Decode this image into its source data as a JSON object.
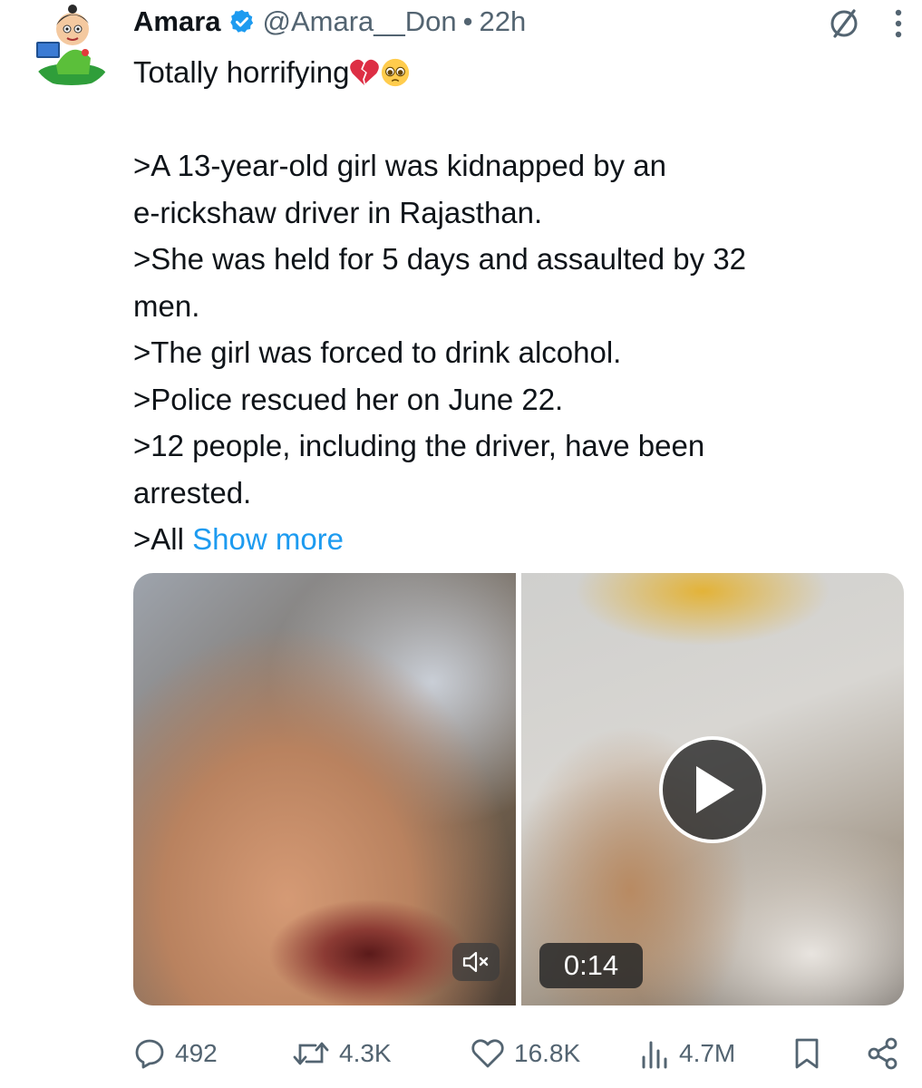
{
  "author": {
    "name": "Amara",
    "handle": "@Amara__Don",
    "separator": "•",
    "time": "22h",
    "verified_color": "#1d9bf0"
  },
  "header_icons": [
    "grok-icon",
    "more-vertical-icon"
  ],
  "tweet": {
    "first_line": "Totally horrifying",
    "first_line_emojis": [
      "broken-heart-emoji",
      "pleading-face-emoji"
    ],
    "lines": [
      ">A 13-year-old girl was kidnapped by an",
      "e-rickshaw driver in Rajasthan.",
      ">She was held for 5 days and assaulted by 32",
      "men.",
      ">The girl was forced to drink alcohol.",
      ">Police rescued her on June 22.",
      ">12 people, including the driver, have been",
      "arrested."
    ],
    "last_line_prefix": ">All ",
    "show_more": "Show more"
  },
  "media": {
    "video_duration": "0:14",
    "mute_icon": "speaker-muted-icon",
    "play_icon": "play-icon"
  },
  "actions": {
    "replies": "492",
    "reposts": "4.3K",
    "likes": "16.8K",
    "views": "4.7M"
  },
  "colors": {
    "text": "#0f1419",
    "secondary": "#536471",
    "link": "#1d9bf0"
  }
}
